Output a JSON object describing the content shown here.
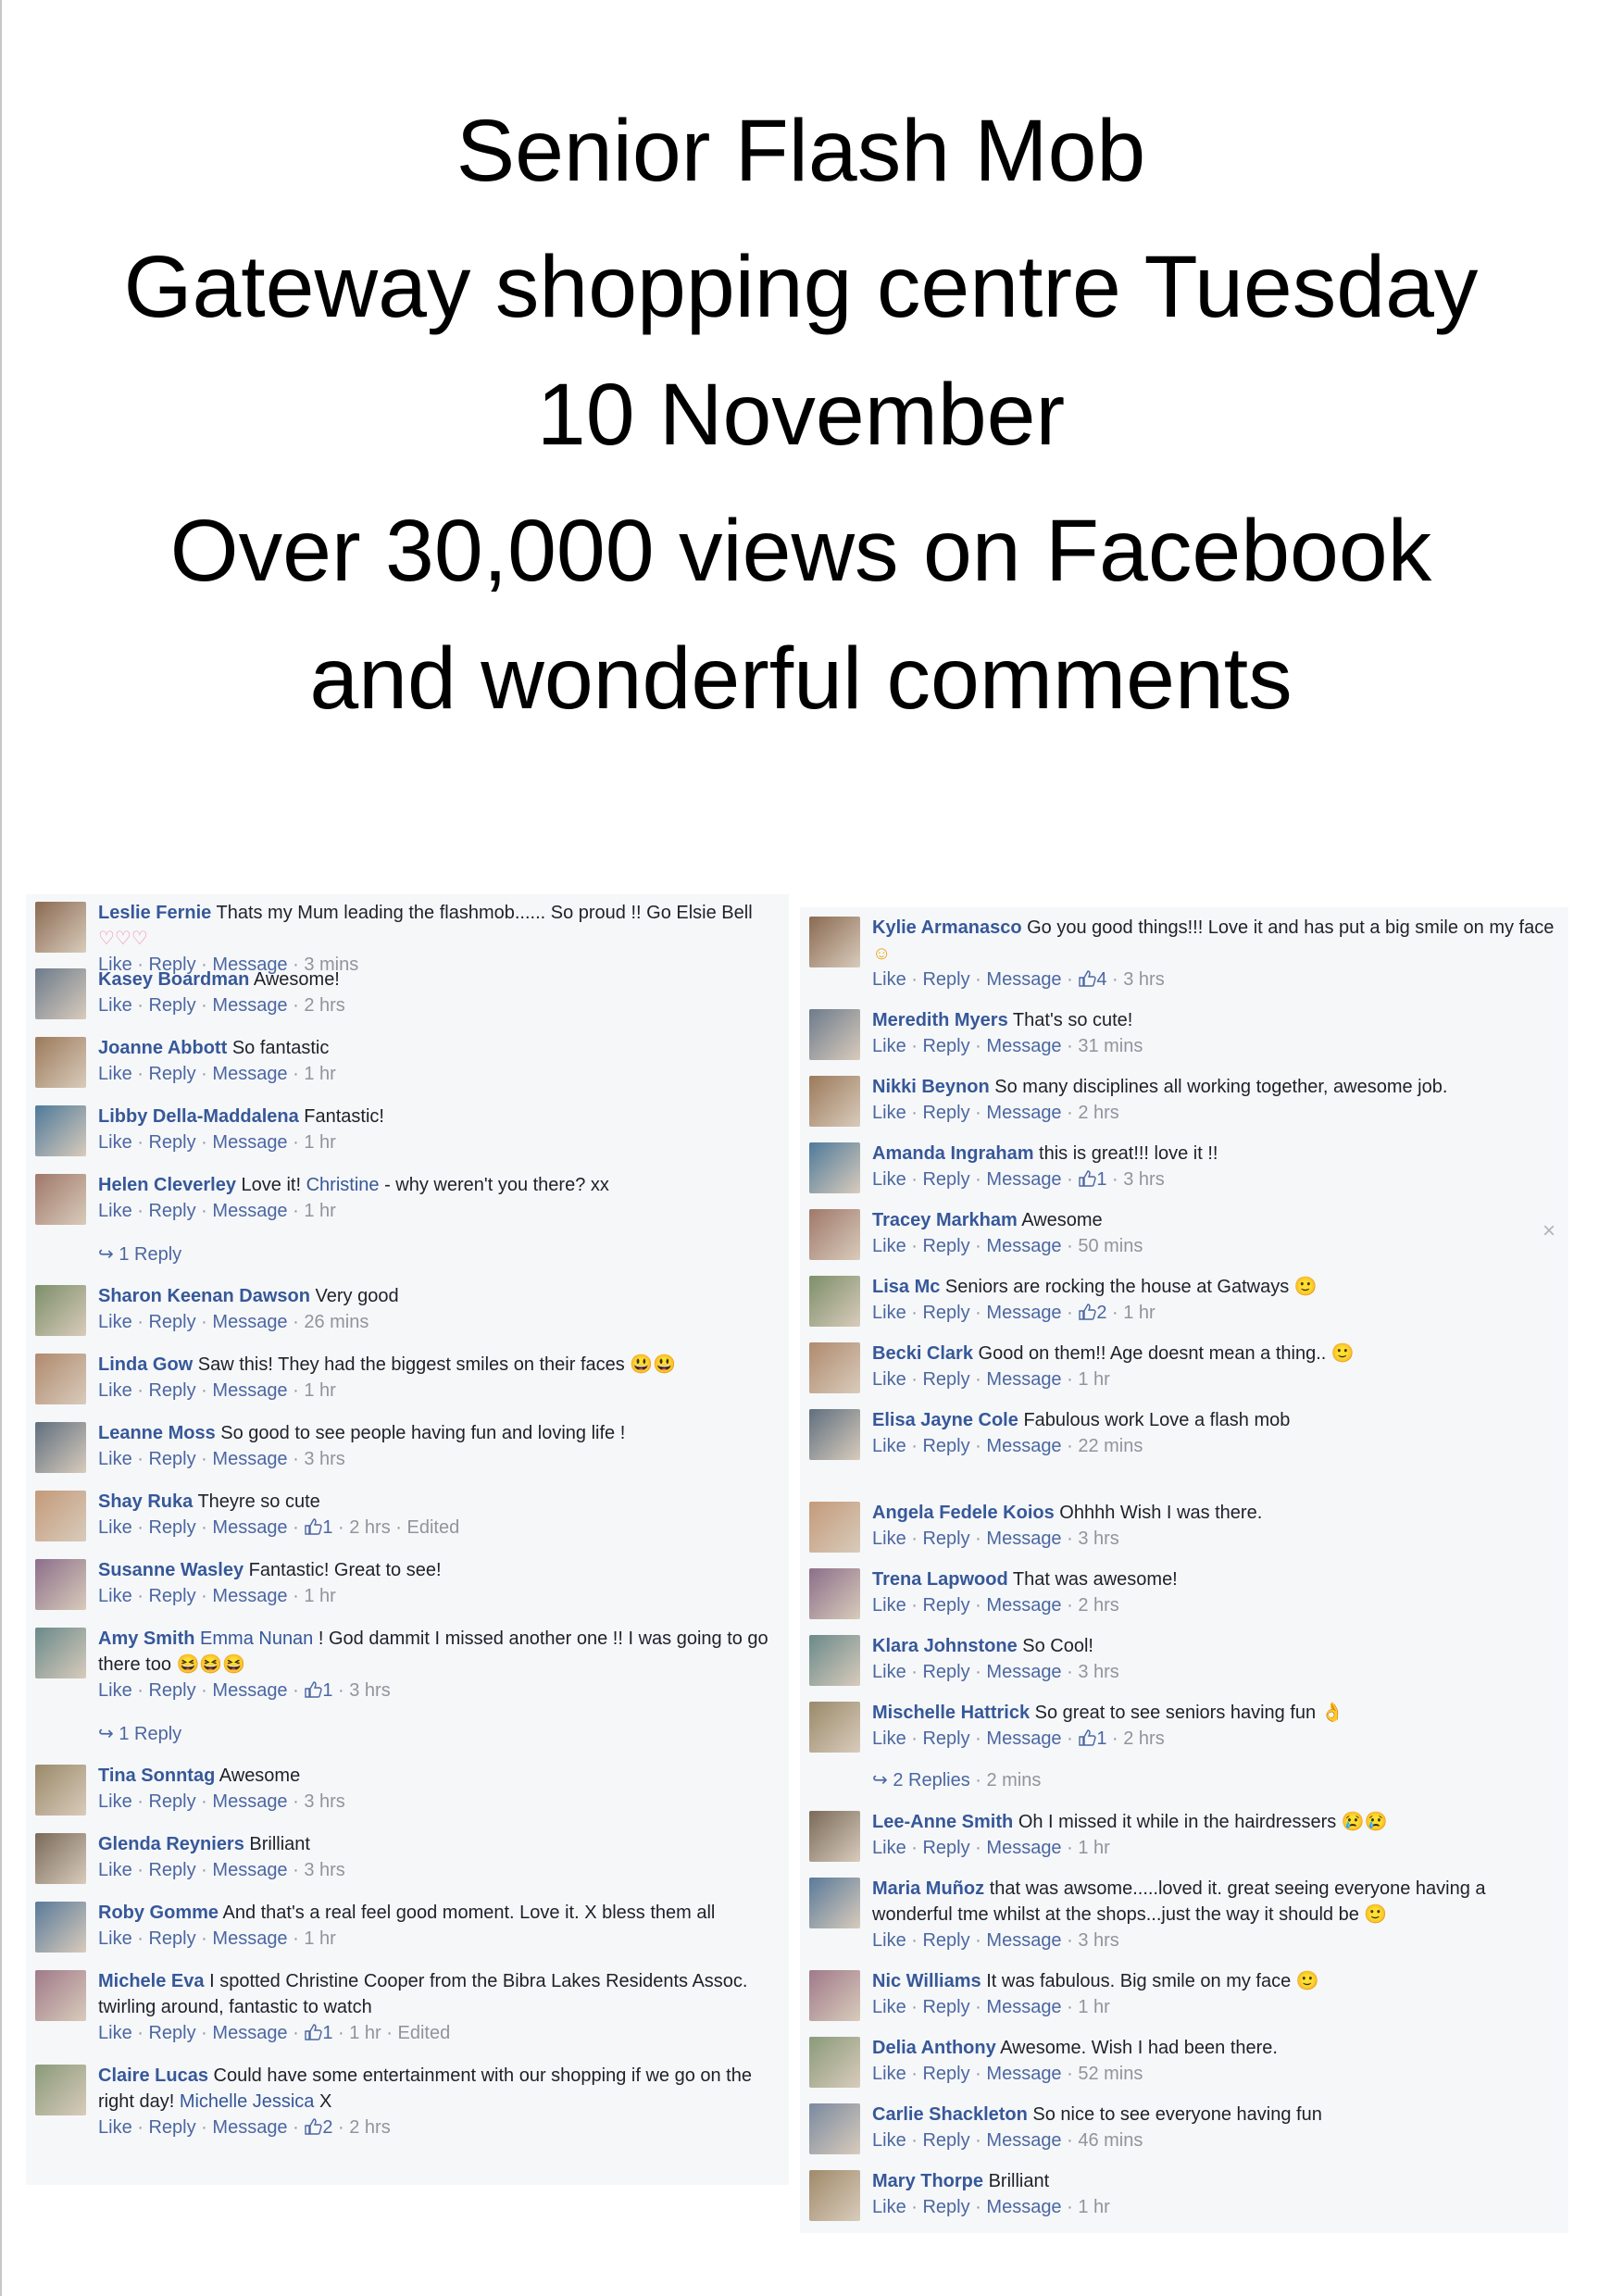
{
  "poster": {
    "title_line1": "Senior Flash Mob",
    "title_line2": "Gateway shopping centre Tuesday",
    "title_line3": "10 November",
    "title_line4": "Over 30,000 views on Facebook",
    "title_line5": "and  wonderful comments"
  },
  "actions": {
    "like": "Like",
    "reply": "Reply",
    "message": "Message",
    "sep": " · ",
    "reply_arrow": "↪",
    "close": "×"
  },
  "colors": {
    "link": "#365899",
    "meta": "#90949c",
    "panel": "#f6f7f9"
  },
  "left_column": {
    "comments": [
      {
        "name": "Leslie Fernie",
        "text": "Thats my Mum leading the flashmob...... So proud !! Go Elsie Bell",
        "emoji": "♡♡♡",
        "likes": "",
        "time": "3 mins",
        "edited": ""
      },
      {
        "name": "Kasey Boardman",
        "text": "Awesome!",
        "likes": "",
        "time": "2 hrs",
        "edited": ""
      },
      {
        "name": "Joanne Abbott",
        "text": "So fantastic",
        "likes": "",
        "time": "1 hr",
        "edited": ""
      },
      {
        "name": "Libby Della-Maddalena",
        "text": "Fantastic!",
        "likes": "",
        "time": "1 hr",
        "edited": ""
      },
      {
        "name": "Helen Cleverley",
        "text": "Love it! ",
        "mention": "Christine",
        "text2": " - why weren't you there? xx",
        "likes": "",
        "time": "1 hr",
        "edited": "",
        "replies": "1 Reply"
      },
      {
        "name": "Sharon Keenan Dawson",
        "text": "Very good",
        "likes": "",
        "time": "26 mins",
        "edited": ""
      },
      {
        "name": "Linda Gow",
        "text": "Saw this! They had the biggest smiles on their faces",
        "emoji": "😃😃",
        "likes": "",
        "time": "1 hr",
        "edited": ""
      },
      {
        "name": "Leanne Moss",
        "text": "So good to see people having fun and loving life !",
        "likes": "",
        "time": "3 hrs",
        "edited": ""
      },
      {
        "name": "Shay Ruka",
        "text": "Theyre so cute",
        "likes": "1",
        "time": "2 hrs",
        "edited": "Edited"
      },
      {
        "name": "Susanne Wasley",
        "text": "Fantastic! Great to see!",
        "likes": "",
        "time": "1 hr",
        "edited": ""
      },
      {
        "name": "Amy Smith",
        "mention": "Emma Nunan",
        "text2": " ! God dammit I missed another one !! I was going to go there too",
        "emoji": "😆😆😆",
        "likes": "1",
        "time": "3 hrs",
        "edited": "",
        "replies": "1 Reply"
      },
      {
        "name": "Tina Sonntag",
        "text": "Awesome",
        "likes": "",
        "time": "3 hrs",
        "edited": ""
      },
      {
        "name": "Glenda Reyniers",
        "text": "Brilliant",
        "likes": "",
        "time": "3 hrs",
        "edited": ""
      },
      {
        "name": "Roby Gomme",
        "text": "And that's a real feel good moment. Love it. X bless them all",
        "likes": "",
        "time": "1 hr",
        "edited": ""
      },
      {
        "name": "Michele Eva",
        "text": "I spotted Christine Cooper from the Bibra Lakes Residents Assoc. twirling around, fantastic to watch",
        "likes": "1",
        "time": "1 hr",
        "edited": "Edited"
      },
      {
        "name": "Claire Lucas",
        "text": "Could have some entertainment with our shopping if we go on the right day! ",
        "mention": "Michelle Jessica",
        "text2": " X",
        "likes": "2",
        "time": "2 hrs",
        "edited": ""
      }
    ]
  },
  "right_column": {
    "comments": [
      {
        "name": "Kylie Armanasco",
        "text": "Go you good things!!! Love it and has put a big smile on my face",
        "emoji": "☺",
        "likes": "4",
        "time": "3 hrs",
        "edited": ""
      },
      {
        "name": "Meredith Myers",
        "text": "That's so cute!",
        "likes": "",
        "time": "31 mins",
        "edited": ""
      },
      {
        "name": "Nikki Beynon",
        "text": "So many disciplines all working together, awesome job.",
        "likes": "",
        "time": "2 hrs",
        "edited": ""
      },
      {
        "name": "Amanda Ingraham",
        "text": "this is great!!! love it !!",
        "likes": "1",
        "time": "3 hrs",
        "edited": ""
      },
      {
        "name": "Tracey Markham",
        "text": "Awesome",
        "likes": "",
        "time": "50 mins",
        "edited": "",
        "close": true
      },
      {
        "name": "Lisa Mc",
        "text": "Seniors are rocking the house at Gatways",
        "emoji": "🙂",
        "likes": "2",
        "time": "1 hr",
        "edited": ""
      },
      {
        "name": "Becki Clark",
        "text": "Good on them!! Age doesnt mean a thing..",
        "emoji": "🙂",
        "likes": "",
        "time": "1 hr",
        "edited": ""
      },
      {
        "name": "Elisa Jayne Cole",
        "text": "Fabulous work Love a flash mob",
        "likes": "",
        "time": "22 mins",
        "edited": ""
      },
      {
        "name": "Angela Fedele Koios",
        "text": "Ohhhh Wish I was there.",
        "likes": "",
        "time": "3 hrs",
        "edited": ""
      },
      {
        "name": "Trena Lapwood",
        "text": "That was awesome!",
        "likes": "",
        "time": "2 hrs",
        "edited": ""
      },
      {
        "name": "Klara Johnstone",
        "text": "So Cool!",
        "likes": "",
        "time": "3 hrs",
        "edited": ""
      },
      {
        "name": "Mischelle Hattrick",
        "text": "So great to see seniors having fun",
        "emoji": "👌",
        "likes": "1",
        "time": "2 hrs",
        "edited": "",
        "replies": "2 Replies",
        "replies_time": "2 mins"
      },
      {
        "name": "Lee-Anne Smith",
        "text": "Oh I missed it while in the hairdressers",
        "emoji": "😢😢",
        "likes": "",
        "time": "1 hr",
        "edited": ""
      },
      {
        "name": "Maria Muñoz",
        "text": "that was awsome.....loved it. great seeing everyone having a wonderful tme whilst at the shops...just the way it should be",
        "emoji": "🙂",
        "likes": "",
        "time": "3 hrs",
        "edited": ""
      },
      {
        "name": "Nic Williams",
        "text": "It was fabulous. Big smile on my face",
        "emoji": "🙂",
        "likes": "",
        "time": "1 hr",
        "edited": ""
      },
      {
        "name": "Delia Anthony",
        "text": "Awesome. Wish I had been there.",
        "likes": "",
        "time": "52 mins",
        "edited": ""
      },
      {
        "name": "Carlie Shackleton",
        "text": "So nice to see everyone having fun",
        "likes": "",
        "time": "46 mins",
        "edited": ""
      },
      {
        "name": "Mary Thorpe",
        "text": "Brilliant",
        "likes": "",
        "time": "1 hr",
        "edited": ""
      }
    ]
  }
}
